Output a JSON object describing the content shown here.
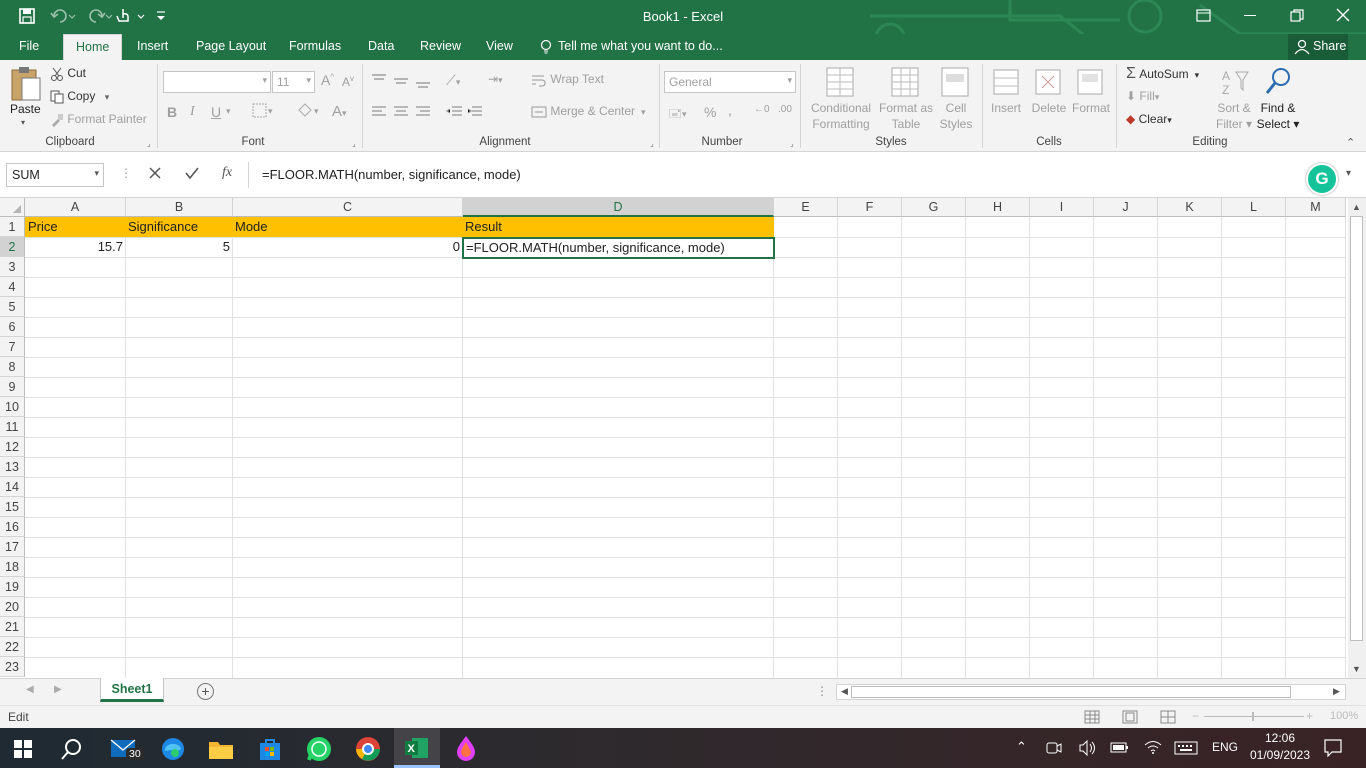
{
  "window": {
    "title": "Book1  -  Excel"
  },
  "tabs": [
    "File",
    "Home",
    "Insert",
    "Page Layout",
    "Formulas",
    "Data",
    "Review",
    "View"
  ],
  "tell_me": "Tell me what you want to do...",
  "share": "Share",
  "clipboard": {
    "paste": "Paste",
    "cut": "Cut",
    "copy": "Copy",
    "format_painter": "Format Painter",
    "label": "Clipboard"
  },
  "font": {
    "name": "",
    "size": "11",
    "label": "Font"
  },
  "alignment": {
    "wrap_text": "Wrap Text",
    "merge_center": "Merge & Center",
    "label": "Alignment"
  },
  "number": {
    "format": "General",
    "label": "Number"
  },
  "styles": {
    "conditional": "Conditional",
    "formatting": "Formatting",
    "format_as": "Format as",
    "table": "Table",
    "cell": "Cell",
    "cell_styles": "Styles",
    "label": "Styles"
  },
  "cells": {
    "insert": "Insert",
    "delete": "Delete",
    "format": "Format",
    "label": "Cells"
  },
  "editing": {
    "autosum": "AutoSum",
    "fill": "Fill",
    "clear": "Clear",
    "sort": "Sort &",
    "filter": "Filter",
    "find": "Find &",
    "select": "Select",
    "label": "Editing"
  },
  "formula_bar": {
    "name_box": "SUM",
    "fx": "fx",
    "formula": "=FLOOR.MATH(number, significance, mode)",
    "grammarly": "G"
  },
  "columns": [
    "A",
    "B",
    "C",
    "D",
    "E",
    "F",
    "G",
    "H",
    "I",
    "J",
    "K",
    "L",
    "M"
  ],
  "rows": [
    "1",
    "2",
    "3",
    "4",
    "5",
    "6",
    "7",
    "8",
    "9",
    "10",
    "11",
    "12",
    "13",
    "14",
    "15",
    "16",
    "17",
    "18",
    "19",
    "20",
    "21",
    "22",
    "23"
  ],
  "sheet": {
    "headers": [
      "Price",
      "Significance",
      "Mode",
      "Result"
    ],
    "values": [
      "15.7",
      "5",
      "0",
      "=FLOOR.MATH(number, significance, mode)"
    ]
  },
  "sheet_tab": "Sheet1",
  "status": {
    "mode": "Edit",
    "zoom": "100%"
  },
  "taskbar": {
    "mail_badge": "30",
    "lang": "ENG",
    "time": "12:06",
    "date": "01/09/2023"
  },
  "colors": {
    "excel_green": "#217346",
    "header_fill": "#ffc000"
  }
}
